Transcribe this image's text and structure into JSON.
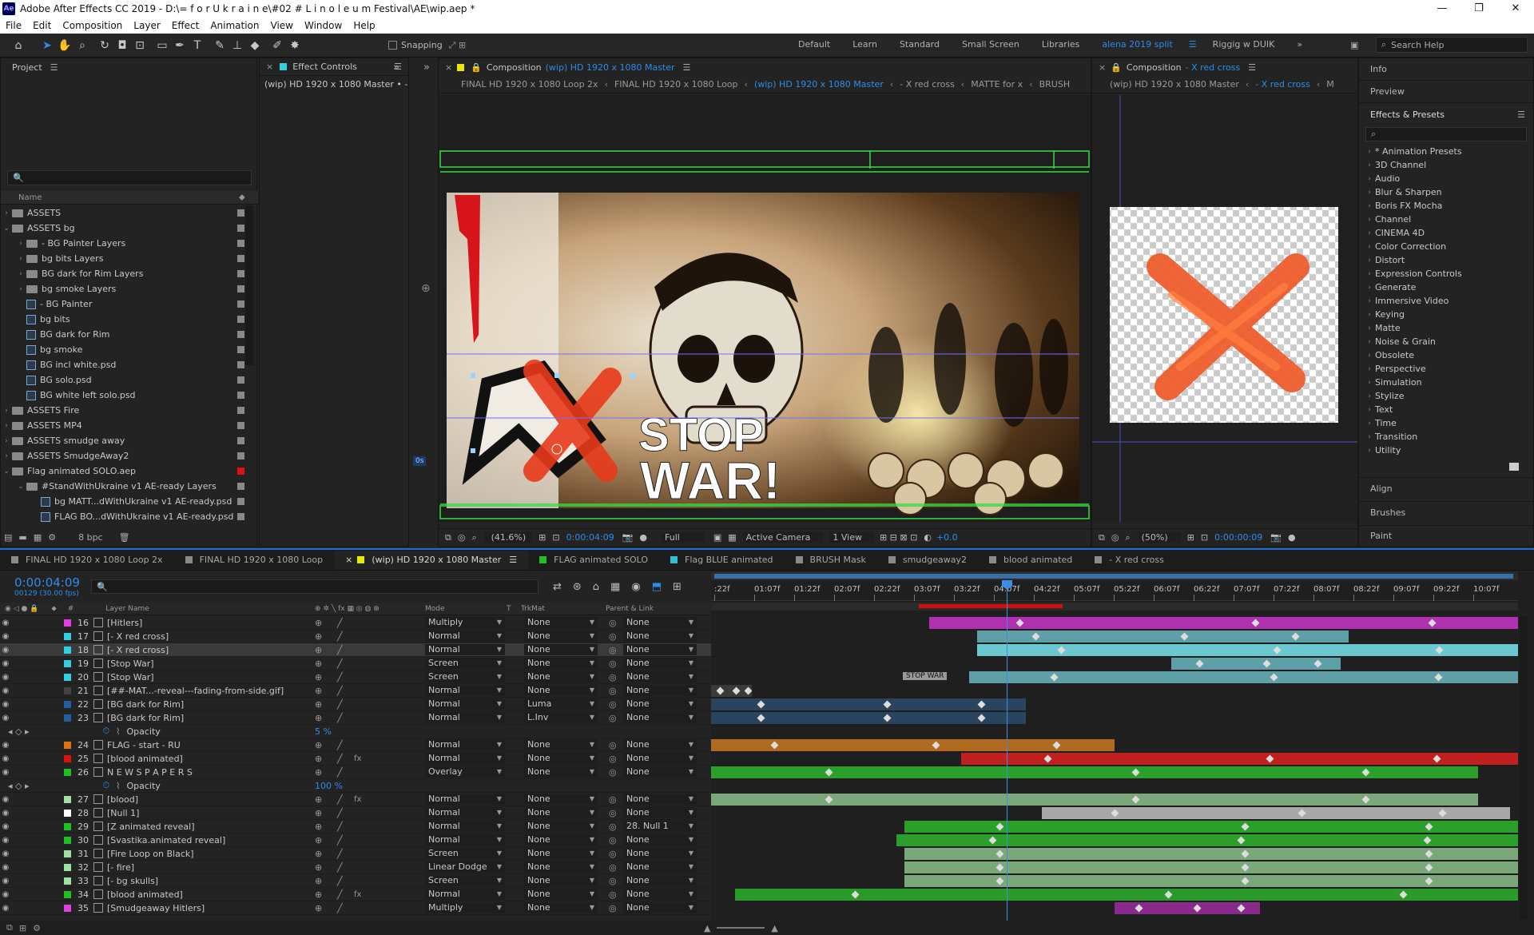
{
  "window": {
    "title": "Adobe After Effects CC 2019 - D:\\= f o r  U k r a i n e\\#02 # L i n o l e u m  Festival\\AE\\wip.aep *",
    "logo": "Ae",
    "controls": [
      "—",
      "❐",
      "✕"
    ]
  },
  "menu": [
    "File",
    "Edit",
    "Composition",
    "Layer",
    "Effect",
    "Animation",
    "View",
    "Window",
    "Help"
  ],
  "toolbar": {
    "snapping": "Snapping",
    "workspaces": [
      "Default",
      "Learn",
      "Standard",
      "Small Screen",
      "Libraries",
      "alena 2019 split",
      "Riggig w DUIK"
    ],
    "active_workspace": "alena 2019 split",
    "search": "Search Help"
  },
  "project": {
    "tab": "Project",
    "column_name": "Name",
    "search_placeholder": "🔍",
    "items": [
      {
        "name": "ASSETS",
        "type": "folder",
        "indent": 0,
        "open": false,
        "color": "#8a8a8a"
      },
      {
        "name": "ASSETS bg",
        "type": "folder",
        "indent": 0,
        "open": true,
        "color": "#8a8a8a"
      },
      {
        "name": "- BG Painter Layers",
        "type": "folder",
        "indent": 1,
        "open": false,
        "color": "#8a8a8a"
      },
      {
        "name": "bg bits Layers",
        "type": "folder",
        "indent": 1,
        "open": false,
        "color": "#8a8a8a"
      },
      {
        "name": "BG dark for Rim Layers",
        "type": "folder",
        "indent": 1,
        "open": false,
        "color": "#8a8a8a"
      },
      {
        "name": "bg smoke Layers",
        "type": "folder",
        "indent": 1,
        "open": false,
        "color": "#8a8a8a"
      },
      {
        "name": "- BG Painter",
        "type": "comp",
        "indent": 1,
        "color": "#8a8a8a"
      },
      {
        "name": "bg bits",
        "type": "comp",
        "indent": 1,
        "color": "#8a8a8a"
      },
      {
        "name": "BG dark for Rim",
        "type": "comp",
        "indent": 1,
        "color": "#8a8a8a"
      },
      {
        "name": "bg smoke",
        "type": "comp",
        "indent": 1,
        "color": "#8a8a8a"
      },
      {
        "name": "BG incl white.psd",
        "type": "file",
        "indent": 1,
        "color": "#8a8a8a"
      },
      {
        "name": "BG solo.psd",
        "type": "file",
        "indent": 1,
        "color": "#8a8a8a"
      },
      {
        "name": "BG white left solo.psd",
        "type": "file",
        "indent": 1,
        "color": "#8a8a8a"
      },
      {
        "name": "ASSETS Fire",
        "type": "folder",
        "indent": 0,
        "open": false,
        "color": "#8a8a8a"
      },
      {
        "name": "ASSETS MP4",
        "type": "folder",
        "indent": 0,
        "open": false,
        "color": "#8a8a8a"
      },
      {
        "name": "ASSETS smudge away",
        "type": "folder",
        "indent": 0,
        "open": false,
        "color": "#8a8a8a"
      },
      {
        "name": "ASSETS SmudgeAway2",
        "type": "folder",
        "indent": 0,
        "open": false,
        "color": "#8a8a8a"
      },
      {
        "name": "Flag animated SOLO.aep",
        "type": "folder",
        "indent": 0,
        "open": true,
        "color": "#e01010"
      },
      {
        "name": "#StandWithUkraine v1 AE-ready Layers",
        "type": "folder",
        "indent": 1,
        "open": true,
        "color": "#8a8a8a"
      },
      {
        "name": "bg MATT...dWithUkraine v1 AE-ready.psd",
        "type": "file",
        "indent": 2,
        "color": "#8a8a8a"
      },
      {
        "name": "FLAG BO...dWithUkraine v1 AE-ready.psd",
        "type": "file",
        "indent": 2,
        "color": "#8a8a8a"
      }
    ],
    "bpc": "8 bpc"
  },
  "effect_controls": {
    "tab": "Effect Controls",
    "sub": "(wip) HD 1920 x 1080 Master • - X re"
  },
  "comp_main": {
    "tab_prefix": "Composition",
    "tab_name": "(wip) HD 1920 x 1080 Master",
    "subtabs": [
      "FINAL HD 1920 x 1080 Loop 2x",
      "FINAL HD 1920 x 1080 Loop",
      "(wip) HD 1920 x 1080 Master",
      "- X red cross",
      "MATTE for x",
      "BRUSH"
    ],
    "active_subtab": "(wip) HD 1920 x 1080 Master",
    "footer": {
      "zoom": "(41.6%)",
      "time": "0:00:04:09",
      "res": "Full",
      "camera": "Active Camera",
      "views": "1 View",
      "exposure": "+0.0"
    },
    "art": {
      "line1": "STOP",
      "line2": "WAR!",
      "tag": "0s"
    }
  },
  "comp_right": {
    "tab_prefix": "Composition",
    "tab_name": "- X red cross",
    "subtabs": [
      "(wip) HD 1920 x 1080 Master",
      "- X red cross",
      "M"
    ],
    "active_subtab": "- X red cross",
    "footer": {
      "zoom": "(50%)",
      "time": "0:00:00:09"
    }
  },
  "right_panels": {
    "info": "Info",
    "preview": "Preview",
    "effects": "Effects & Presets",
    "align": "Align",
    "brushes": "Brushes",
    "paint": "Paint",
    "effects_list": [
      "* Animation Presets",
      "3D Channel",
      "Audio",
      "Blur & Sharpen",
      "Boris FX Mocha",
      "Channel",
      "CINEMA 4D",
      "Color Correction",
      "Distort",
      "Expression Controls",
      "Generate",
      "Immersive Video",
      "Keying",
      "Matte",
      "Noise & Grain",
      "Obsolete",
      "Perspective",
      "Simulation",
      "Stylize",
      "Text",
      "Time",
      "Transition",
      "Utility"
    ]
  },
  "timeline": {
    "tabs": [
      {
        "name": "FINAL HD 1920 x 1080 Loop 2x",
        "color": "#8a8a8a"
      },
      {
        "name": "FINAL HD 1920 x 1080 Loop",
        "color": "#8a8a8a"
      },
      {
        "name": "(wip) HD 1920 x 1080 Master",
        "color": "#e8e800",
        "active": true
      },
      {
        "name": "FLAG animated SOLO",
        "color": "#20c020"
      },
      {
        "name": "Flag BLUE animated",
        "color": "#30c0d0"
      },
      {
        "name": "BRUSH Mask",
        "color": "#8a8a8a"
      },
      {
        "name": "smudgeaway2",
        "color": "#8a8a8a"
      },
      {
        "name": "blood animated",
        "color": "#8a8a8a"
      },
      {
        "name": "- X red cross",
        "color": "#8a8a8a"
      }
    ],
    "timecode": "0:00:04:09",
    "frames": "00129 (30.00 fps)",
    "search": "🔍",
    "headers": {
      "layer_name": "Layer Name",
      "mode": "Mode",
      "t": "T",
      "trkmat": "TrkMat",
      "parent": "Parent & Link"
    },
    "ruler": [
      ":22f",
      "01:07f",
      "01:22f",
      "02:07f",
      "02:22f",
      "03:07f",
      "03:22f",
      "04:07f",
      "04:22f",
      "05:07f",
      "05:22f",
      "06:07f",
      "06:22f",
      "07:07f",
      "07:22f",
      "08:07f",
      "08:22f",
      "09:07f",
      "09:22f",
      "10:07f"
    ],
    "layers": [
      {
        "num": "16",
        "name": "[Hitlers]",
        "label": "#e040e0",
        "mode": "Multiply",
        "trk": "None",
        "parent": "None",
        "bar": {
          "s": 0.27,
          "e": 1.0,
          "c": "#b030b0"
        }
      },
      {
        "num": "17",
        "name": "[- X red cross]",
        "label": "#30d0e0",
        "mode": "Normal",
        "trk": "None",
        "parent": "None",
        "bar": {
          "s": 0.33,
          "e": 0.79,
          "c": "#5fa0a8"
        }
      },
      {
        "num": "18",
        "name": "[- X red cross]",
        "label": "#30d0e0",
        "mode": "Normal",
        "trk": "None",
        "parent": "None",
        "selected": true,
        "bar": {
          "s": 0.33,
          "e": 1.0,
          "c": "#6cc8d0"
        }
      },
      {
        "num": "19",
        "name": "[Stop War]",
        "label": "#30d0e0",
        "mode": "Screen",
        "trk": "None",
        "parent": "None",
        "bar": {
          "s": 0.57,
          "e": 0.78,
          "c": "#5fa0a8"
        }
      },
      {
        "num": "20",
        "name": "[Stop War]",
        "label": "#30d0e0",
        "mode": "Screen",
        "trk": "None",
        "parent": "None",
        "bar": {
          "s": 0.32,
          "e": 1.0,
          "c": "#5fa0a8"
        },
        "tag": "STOP WAR"
      },
      {
        "num": "21",
        "name": "[##-MAT...-reveal---fading-from-side.gif]",
        "label": "#444444",
        "mode": "Normal",
        "trk": "None",
        "parent": "None",
        "bar": {
          "s": 0.0,
          "e": 0.05,
          "c": "#3a3a3a"
        }
      },
      {
        "num": "22",
        "name": "[BG dark for Rim]",
        "label": "#2060a0",
        "mode": "Normal",
        "trk": "Luma",
        "parent": "None",
        "bar": {
          "s": 0.0,
          "e": 0.39,
          "c": "#2a4460"
        }
      },
      {
        "num": "23",
        "name": "[BG dark for Rim]",
        "label": "#2060a0",
        "mode": "Normal",
        "trk": "L.Inv",
        "parent": "None",
        "bar": {
          "s": 0.0,
          "e": 0.39,
          "c": "#2a4460"
        }
      },
      {
        "prop": true,
        "name": "Opacity",
        "value": "5 %"
      },
      {
        "num": "24",
        "name": "FLAG - start - RU",
        "label": "#e07010",
        "mode": "Normal",
        "trk": "None",
        "parent": "None",
        "bar": {
          "s": 0.0,
          "e": 0.5,
          "c": "#b06a20"
        }
      },
      {
        "num": "25",
        "name": "[blood animated]",
        "label": "#e01010",
        "mode": "Normal",
        "trk": "None",
        "parent": "None",
        "fx": true,
        "bar": {
          "s": 0.31,
          "e": 1.0,
          "c": "#c02020"
        }
      },
      {
        "num": "26",
        "name": "N E W S P A P E R S",
        "label": "#20c020",
        "mode": "Overlay",
        "trk": "None",
        "parent": "None",
        "bar": {
          "s": 0.0,
          "e": 0.95,
          "c": "#2aa02a"
        }
      },
      {
        "prop": true,
        "name": "Opacity",
        "value": "100 %"
      },
      {
        "num": "27",
        "name": "[blood]",
        "label": "#a0e0a0",
        "mode": "Normal",
        "trk": "None",
        "parent": "None",
        "fx": true,
        "bar": {
          "s": 0.0,
          "e": 0.95,
          "c": "#7aa87a"
        }
      },
      {
        "num": "28",
        "name": "[Null 1]",
        "label": "#ffffff",
        "mode": "Normal",
        "trk": "None",
        "parent": "None",
        "bar": {
          "s": 0.41,
          "e": 0.99,
          "c": "#a8a8a8"
        }
      },
      {
        "num": "29",
        "name": "[Z animated reveal]",
        "label": "#20c020",
        "mode": "Normal",
        "trk": "None",
        "parent": "28. Null 1",
        "bar": {
          "s": 0.24,
          "e": 1.0,
          "c": "#2aa02a"
        }
      },
      {
        "num": "30",
        "name": "[Svastika.animated reveal]",
        "label": "#20c020",
        "mode": "Normal",
        "trk": "None",
        "parent": "None",
        "bar": {
          "s": 0.23,
          "e": 1.0,
          "c": "#2aa02a"
        }
      },
      {
        "num": "31",
        "name": "[Fire Loop on Black]",
        "label": "#a0e0a0",
        "mode": "Screen",
        "trk": "None",
        "parent": "None",
        "bar": {
          "s": 0.24,
          "e": 1.0,
          "c": "#7aa87a"
        }
      },
      {
        "num": "32",
        "name": "[- fire]",
        "label": "#a0e0a0",
        "mode": "Linear Dodge",
        "trk": "None",
        "parent": "None",
        "bar": {
          "s": 0.24,
          "e": 1.0,
          "c": "#7aa87a"
        }
      },
      {
        "num": "33",
        "name": "[- bg skulls]",
        "label": "#a0e0a0",
        "mode": "Screen",
        "trk": "None",
        "parent": "None",
        "bar": {
          "s": 0.24,
          "e": 1.0,
          "c": "#7aa87a"
        }
      },
      {
        "num": "34",
        "name": "[blood animated]",
        "label": "#20c020",
        "mode": "Normal",
        "trk": "None",
        "parent": "None",
        "fx": true,
        "bar": {
          "s": 0.03,
          "e": 1.0,
          "c": "#2a9a2a"
        }
      },
      {
        "num": "35",
        "name": "[Smudgeaway Hitlers]",
        "label": "#e040e0",
        "mode": "Multiply",
        "trk": "None",
        "parent": "None",
        "bar": {
          "s": 0.5,
          "e": 0.68,
          "c": "#8a2a8a"
        }
      }
    ]
  }
}
